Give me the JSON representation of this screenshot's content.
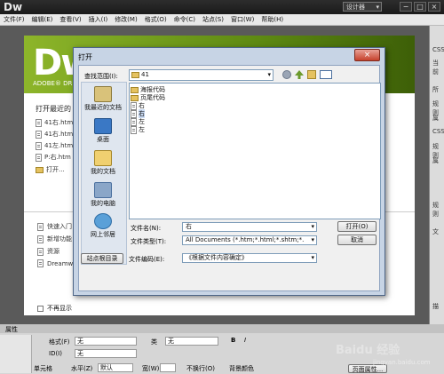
{
  "app": {
    "logo": "Dw",
    "workspace": "设计器",
    "win_min": "−",
    "win_max": "□",
    "win_close": "×"
  },
  "menu": [
    "文件(F)",
    "编辑(E)",
    "查看(V)",
    "插入(I)",
    "修改(M)",
    "格式(O)",
    "命令(C)",
    "站点(S)",
    "窗口(W)",
    "帮助(H)"
  ],
  "welcome": {
    "banner_logo": "Dw",
    "banner_sub": "ADOBE® DR",
    "recent_title": "打开最近的",
    "recent": [
      "41右.htm",
      "41右.htm",
      "41左.htm",
      "P:右.htm"
    ],
    "open_more": "打开...",
    "lower": [
      "快速入门",
      "新增功能",
      "资源",
      "Dreamw"
    ],
    "no_show": "不再显示"
  },
  "right_panel": [
    "CSS",
    "当前",
    "所",
    "规则",
    "属",
    "CSS",
    "规则",
    "属",
    "规则",
    "文",
    "描"
  ],
  "dialog": {
    "title": "打开",
    "close": "×",
    "lookin_label": "查找范围(I):",
    "lookin_value": "41",
    "places": [
      "我最近的文档",
      "桌面",
      "我的文档",
      "我的电脑",
      "网上邻居"
    ],
    "files": [
      {
        "name": "海报代码",
        "type": "folder",
        "selected": false
      },
      {
        "name": "页尾代码",
        "type": "folder",
        "selected": false
      },
      {
        "name": "右",
        "type": "file",
        "selected": false
      },
      {
        "name": "右",
        "type": "file",
        "selected": true
      },
      {
        "name": "左",
        "type": "file",
        "selected": false
      },
      {
        "name": "左",
        "type": "file",
        "selected": false
      }
    ],
    "filename_label": "文件名(N):",
    "filename_value": "右",
    "filetype_label": "文件类型(T):",
    "filetype_value": "All Documents (*.htm;*.html;*.shtm;*.",
    "encoding_label": "文件编码(E):",
    "encoding_value": "《根据文件内容确定》",
    "open_button": "打开(O)",
    "cancel_button": "取消",
    "site_root_button": "站点根目录"
  },
  "properties": {
    "header": "属性",
    "format_label": "格式(F)",
    "format_value": "无",
    "class_label": "类",
    "class_value": "无",
    "id_label": "ID(I)",
    "id_value": "无",
    "cell_label": "单元格",
    "halign_label": "水平(Z)",
    "halign_value": "默认",
    "width_label": "宽(W)",
    "nowrap_label": "不换行(O)",
    "bg_label": "背景颜色",
    "page_props": "页面属性...",
    "bold": "B",
    "italic": "I"
  },
  "watermark": {
    "text": "Baidu 经验",
    "sub": "jingyan.baidu.com"
  }
}
